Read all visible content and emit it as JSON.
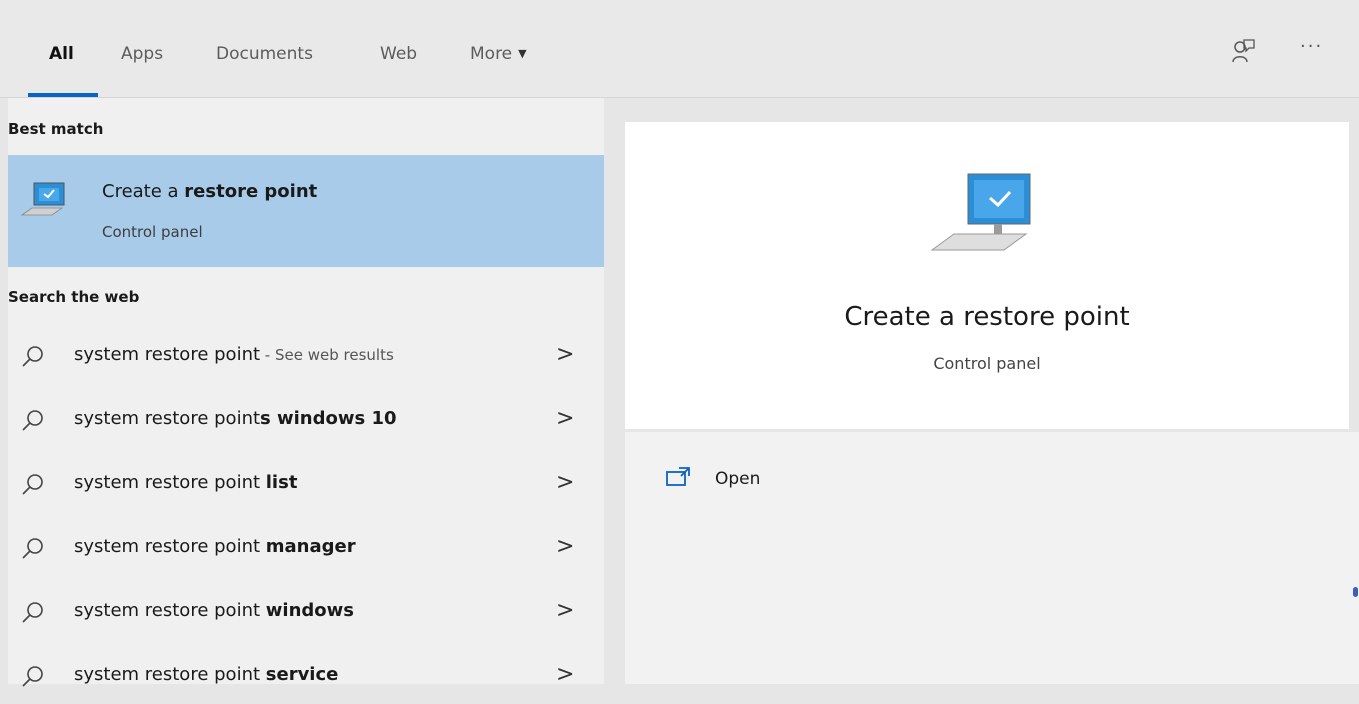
{
  "tabs": [
    {
      "label": "All",
      "active": true
    },
    {
      "label": "Apps"
    },
    {
      "label": "Documents"
    },
    {
      "label": "Web"
    },
    {
      "label": "More"
    }
  ],
  "header_icons": {
    "feedback": "feedback-icon",
    "more": "···"
  },
  "left": {
    "best_match_label": "Best match",
    "best_match": {
      "title_pre": "Create a ",
      "title_bold": "restore point",
      "subtitle": "Control panel"
    },
    "search_web_label": "Search the web",
    "web_results": [
      {
        "pre": "system restore point",
        "bold": "",
        "hint": " - See web results"
      },
      {
        "pre": "system restore point",
        "bold": "s windows 10",
        "hint": ""
      },
      {
        "pre": "system restore point ",
        "bold": "list",
        "hint": ""
      },
      {
        "pre": "system restore point ",
        "bold": "manager",
        "hint": ""
      },
      {
        "pre": "system restore point ",
        "bold": "windows",
        "hint": ""
      },
      {
        "pre": "system restore point ",
        "bold": "service",
        "hint": ""
      }
    ]
  },
  "right": {
    "title": "Create a restore point",
    "subtitle": "Control panel",
    "actions": [
      {
        "label": "Open",
        "icon": "open-window-icon"
      }
    ]
  },
  "colors": {
    "accent": "#0a64c8",
    "selection": "#a7cbe9"
  }
}
